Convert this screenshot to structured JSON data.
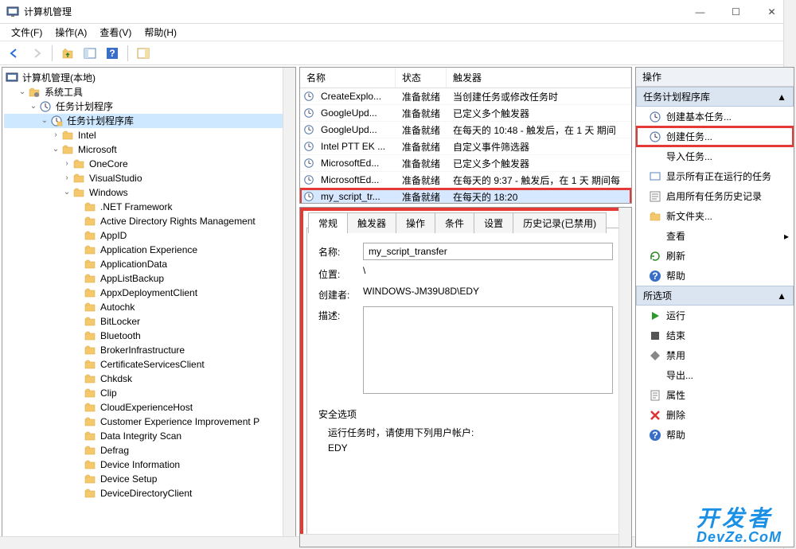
{
  "window": {
    "title": "计算机管理"
  },
  "menu": {
    "file": "文件(F)",
    "action": "操作(A)",
    "view": "查看(V)",
    "help": "帮助(H)"
  },
  "tree": {
    "root": "计算机管理(本地)",
    "systools": "系统工具",
    "scheduler": "任务计划程序",
    "library": "任务计划程序库",
    "intel": "Intel",
    "microsoft": "Microsoft",
    "onecore": "OneCore",
    "vs": "VisualStudio",
    "windows": "Windows",
    "items": [
      ".NET Framework",
      "Active Directory Rights Management",
      "AppID",
      "Application Experience",
      "ApplicationData",
      "AppListBackup",
      "AppxDeploymentClient",
      "Autochk",
      "BitLocker",
      "Bluetooth",
      "BrokerInfrastructure",
      "CertificateServicesClient",
      "Chkdsk",
      "Clip",
      "CloudExperienceHost",
      "Customer Experience Improvement P",
      "Data Integrity Scan",
      "Defrag",
      "Device Information",
      "Device Setup",
      "DeviceDirectoryClient"
    ]
  },
  "tasklist": {
    "hdr": {
      "name": "名称",
      "status": "状态",
      "trigger": "触发器"
    },
    "rows": [
      {
        "name": "CreateExplo...",
        "status": "准备就绪",
        "trigger": "当创建任务或修改任务时"
      },
      {
        "name": "GoogleUpd...",
        "status": "准备就绪",
        "trigger": "已定义多个触发器"
      },
      {
        "name": "GoogleUpd...",
        "status": "准备就绪",
        "trigger": "在每天的 10:48 - 触发后，在 1 天 期间"
      },
      {
        "name": "Intel PTT EK ...",
        "status": "准备就绪",
        "trigger": "自定义事件筛选器"
      },
      {
        "name": "MicrosoftEd...",
        "status": "准备就绪",
        "trigger": "已定义多个触发器"
      },
      {
        "name": "MicrosoftEd...",
        "status": "准备就绪",
        "trigger": "在每天的 9:37 - 触发后，在 1 天 期间每"
      },
      {
        "name": "my_script_tr...",
        "status": "准备就绪",
        "trigger": "在每天的 18:20",
        "sel": true
      }
    ]
  },
  "detail": {
    "tabs": {
      "general": "常规",
      "triggers": "触发器",
      "actions": "操作",
      "conditions": "条件",
      "settings": "设置",
      "history": "历史记录(已禁用)"
    },
    "labels": {
      "name": "名称:",
      "location": "位置:",
      "author": "创建者:",
      "desc": "描述:",
      "sec": "安全选项",
      "runas": "运行任务时，请使用下列用户帐户:"
    },
    "values": {
      "name": "my_script_transfer",
      "location": "\\",
      "author": "WINDOWS-JM39U8D\\EDY",
      "desc": "",
      "user": "EDY"
    }
  },
  "actions": {
    "hdr": "操作",
    "grp1": "任务计划程序库",
    "grp2": "所选项",
    "g1": {
      "createBasic": "创建基本任务...",
      "createTask": "创建任务...",
      "import": "导入任务...",
      "showRunning": "显示所有正在运行的任务",
      "enableHistory": "启用所有任务历史记录",
      "newFolder": "新文件夹...",
      "view": "查看",
      "refresh": "刷新",
      "help": "帮助"
    },
    "g2": {
      "run": "运行",
      "end": "结束",
      "disable": "禁用",
      "export": "导出...",
      "props": "属性",
      "delete": "删除",
      "help": "帮助"
    }
  },
  "watermark": {
    "l1": "开发者",
    "l2": "DevZe.CoM"
  }
}
